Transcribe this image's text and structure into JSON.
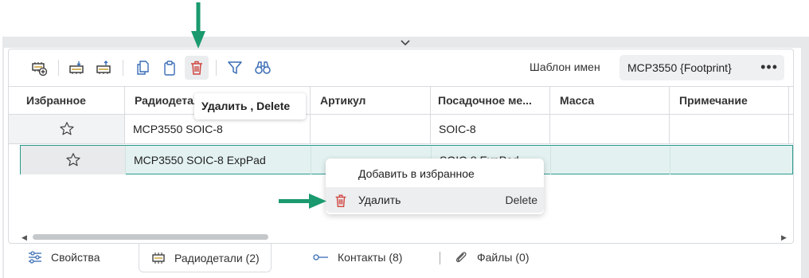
{
  "toolbar": {
    "buttons": [
      {
        "name": "add-component-icon"
      },
      {
        "name": "import-icon"
      },
      {
        "name": "export-icon"
      },
      {
        "name": "copy-icon"
      },
      {
        "name": "paste-icon"
      },
      {
        "name": "delete-icon"
      },
      {
        "name": "filter-icon"
      },
      {
        "name": "binoculars-icon"
      }
    ],
    "template_label": "Шаблон имен",
    "template_value": "MCP3550 {Footprint}",
    "more_label": "•••"
  },
  "table": {
    "columns": [
      "Избранное",
      "Радиодетали",
      "Артикул",
      "Посадочное ме...",
      "Масса",
      "Примечание"
    ],
    "rows": [
      {
        "name": "MCP3550 SOIC-8",
        "article": "",
        "footprint": "SOIC-8",
        "mass": "",
        "note": "",
        "selected": false
      },
      {
        "name": "MCP3550 SOIC-8 ExpPad",
        "article": "",
        "footprint": "SOIC-8 ExpPad",
        "mass": "",
        "note": "",
        "selected": true
      }
    ]
  },
  "tooltip": {
    "text": "Удалить , Delete"
  },
  "context_menu": {
    "items": [
      {
        "label": "Добавить в избранное",
        "shortcut": ""
      },
      {
        "label": "Удалить",
        "shortcut": "Delete"
      }
    ]
  },
  "tabs": [
    {
      "label": "Свойства",
      "icon": "sliders-icon",
      "active": false
    },
    {
      "label": "Радиодетали (2)",
      "icon": "chip-icon",
      "active": true
    },
    {
      "label": "Контакты (8)",
      "icon": "pin-icon",
      "active": false
    },
    {
      "label": "Файлы (0)",
      "icon": "paperclip-icon",
      "active": false
    }
  ],
  "colors": {
    "accent": "#2a9a8c",
    "delete": "#d0453f",
    "toolbar_icon": "#3a6db5",
    "annotation_arrow": "#1a9a6e"
  }
}
